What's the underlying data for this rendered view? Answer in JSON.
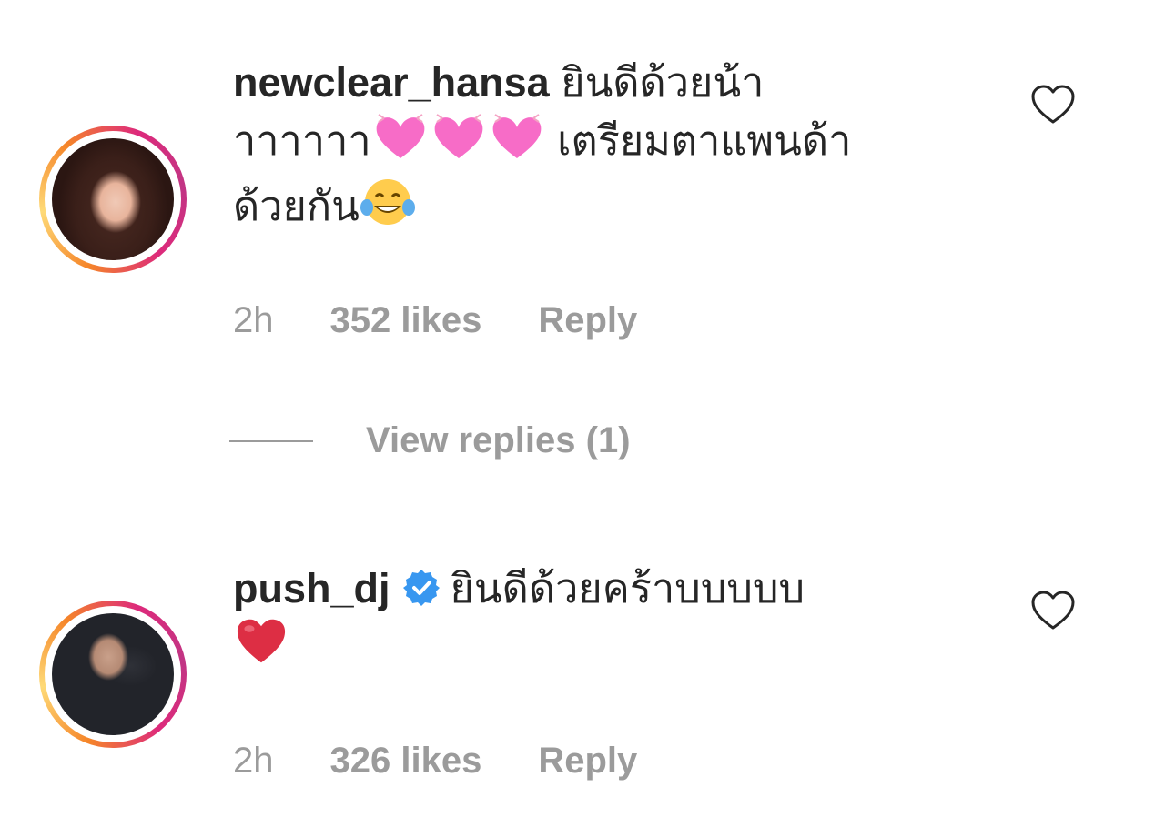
{
  "comments": [
    {
      "username": "newclear_hansa",
      "text_line1": " ยินดีด้วยน้า",
      "text_line2_a": "าาาาาา",
      "text_line2_b": " เตรียมตาแพนด้า",
      "text_line3": "ด้วยกัน",
      "emojis": [
        "heart-eyes-pink-heart-emoji",
        "heart-eyes-pink-heart-emoji",
        "heart-eyes-pink-heart-emoji",
        "tears-of-joy-emoji"
      ],
      "time": "2h",
      "likes": "352 likes",
      "reply_label": "Reply",
      "view_replies": "View replies (1)"
    },
    {
      "username": "push_dj",
      "verified": true,
      "text_line1": "ยินดีด้วยคร้าบบบบบ",
      "emojis": [
        "red-heart-emoji"
      ],
      "time": "2h",
      "likes": "326 likes",
      "reply_label": "Reply"
    }
  ],
  "colors": {
    "text": "#262626",
    "meta": "#9b9b9b",
    "verified": "#3897f0",
    "story_ring_start": "#f58529",
    "story_ring_end": "#c13584"
  }
}
